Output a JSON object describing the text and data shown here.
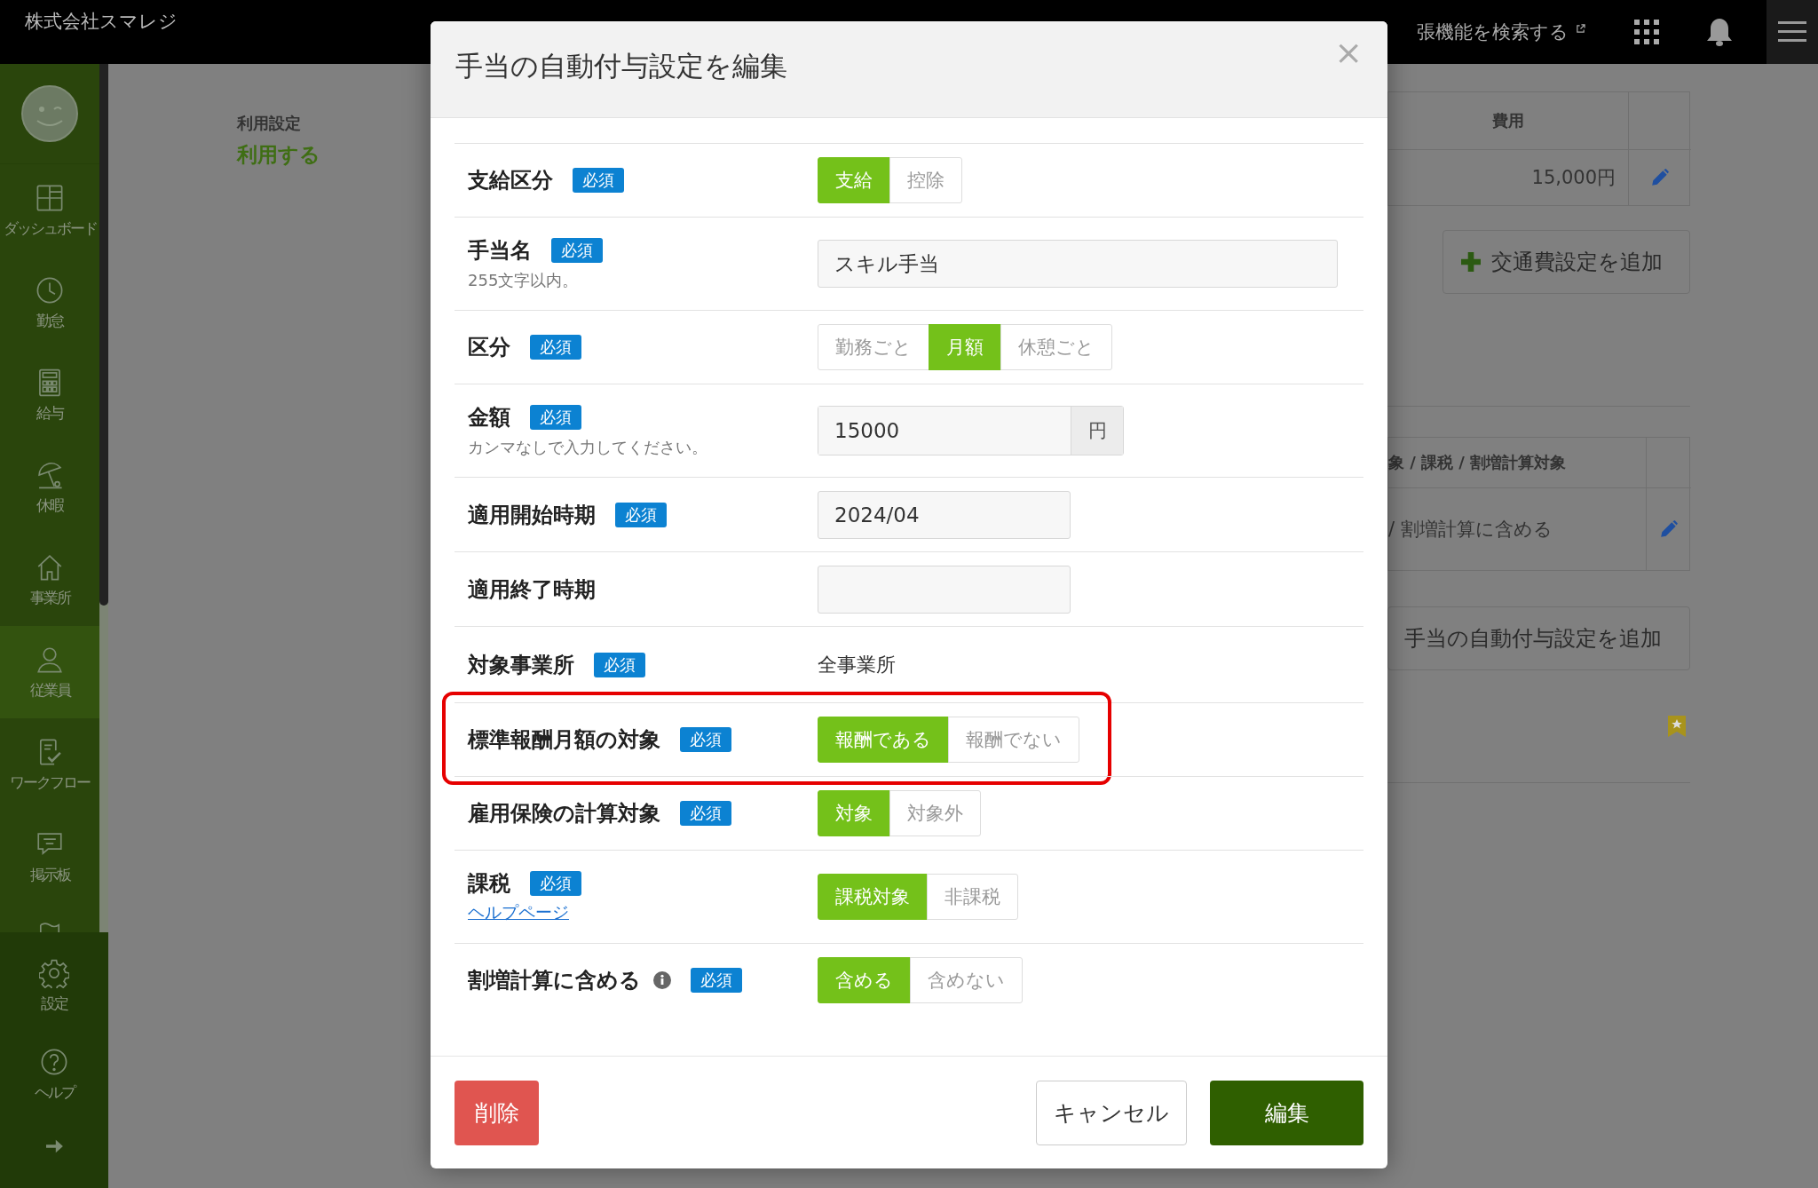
{
  "header": {
    "company": "株式会社スマレジ",
    "search_link": "張機能を検索する"
  },
  "sidebar": {
    "items": [
      {
        "label": "ダッシュボード",
        "selected": false
      },
      {
        "label": "勤怠",
        "selected": false
      },
      {
        "label": "給与",
        "selected": false
      },
      {
        "label": "休暇",
        "selected": false
      },
      {
        "label": "事業所",
        "selected": false
      },
      {
        "label": "従業員",
        "selected": true
      },
      {
        "label": "ワークフロー",
        "selected": false
      },
      {
        "label": "掲示板",
        "selected": false
      }
    ],
    "bottom_items": [
      {
        "label": "設定"
      },
      {
        "label": "ヘルプ"
      }
    ]
  },
  "background": {
    "setting_label": "利用設定",
    "setting_value": "利用する",
    "cost_header": "費用",
    "cost_value": "15,000円",
    "add_transport_button": "交通費設定を追加",
    "allowance_header": "象 / 課税 / 割増計算対象",
    "allowance_value": "/ 割増計算に含める",
    "add_allowance_button": "手当の自動付与設定を追加"
  },
  "modal": {
    "title": "手当の自動付与設定を編集",
    "close": "×",
    "rows": [
      {
        "kind": "toggle",
        "label": "支給区分",
        "required": "必須",
        "options": [
          {
            "label": "支給",
            "selected": true
          },
          {
            "label": "控除",
            "selected": false
          }
        ]
      },
      {
        "kind": "text",
        "label": "手当名",
        "required": "必須",
        "hint": "255文字以内。",
        "value": "スキル手当"
      },
      {
        "kind": "toggle",
        "label": "区分",
        "required": "必須",
        "options": [
          {
            "label": "勤務ごと",
            "selected": false
          },
          {
            "label": "月額",
            "selected": true
          },
          {
            "label": "休憩ごと",
            "selected": false
          }
        ]
      },
      {
        "kind": "amount",
        "label": "金額",
        "required": "必須",
        "hint": "カンマなしで入力してください。",
        "value": "15000",
        "unit": "円"
      },
      {
        "kind": "date",
        "label": "適用開始時期",
        "required": "必須",
        "value": "2024/04"
      },
      {
        "kind": "date",
        "label": "適用終了時期"
      },
      {
        "kind": "static",
        "label": "対象事業所",
        "required": "必須",
        "value": "全事業所"
      },
      {
        "kind": "toggle",
        "label": "標準報酬月額の対象",
        "required": "必須",
        "highlighted": true,
        "options": [
          {
            "label": "報酬である",
            "selected": true
          },
          {
            "label": "報酬でない",
            "selected": false
          }
        ]
      },
      {
        "kind": "toggle",
        "label": "雇用保険の計算対象",
        "required": "必須",
        "options": [
          {
            "label": "対象",
            "selected": true
          },
          {
            "label": "対象外",
            "selected": false
          }
        ]
      },
      {
        "kind": "toggle",
        "label": "課税",
        "required": "必須",
        "help_link": "ヘルプページ",
        "options": [
          {
            "label": "課税対象",
            "selected": true
          },
          {
            "label": "非課税",
            "selected": false
          }
        ]
      },
      {
        "kind": "toggle",
        "label": "割増計算に含める",
        "required": "必須",
        "info": true,
        "options": [
          {
            "label": "含める",
            "selected": true
          },
          {
            "label": "含めない",
            "selected": false
          }
        ]
      }
    ],
    "footer": {
      "delete": "削除",
      "cancel": "キャンセル",
      "submit": "編集"
    }
  }
}
